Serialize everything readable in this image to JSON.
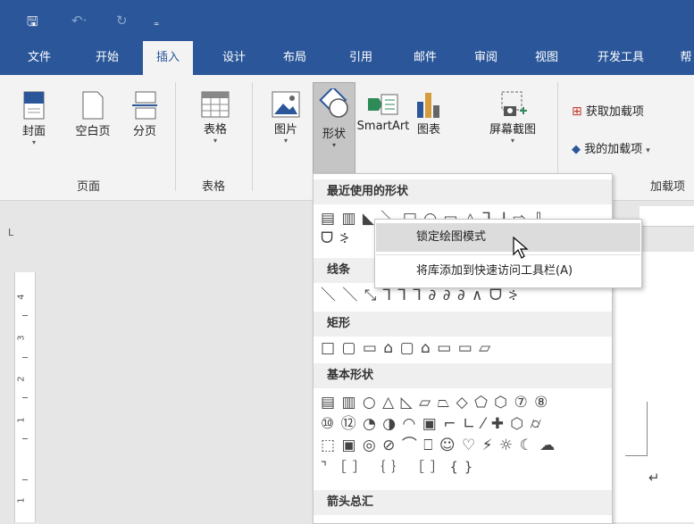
{
  "qat": {
    "save_icon": "save-icon",
    "undo_icon": "undo-icon",
    "redo_icon": "redo-icon",
    "customize_icon": "customize-qat-icon",
    "save": "🖫",
    "undo": "↶·",
    "redo": "↻",
    "customize": "₌"
  },
  "tabs": [
    {
      "label": "文件"
    },
    {
      "label": "开始"
    },
    {
      "label": "插入"
    },
    {
      "label": "设计"
    },
    {
      "label": "布局"
    },
    {
      "label": "引用"
    },
    {
      "label": "邮件"
    },
    {
      "label": "审阅"
    },
    {
      "label": "视图"
    },
    {
      "label": "开发工具"
    },
    {
      "label": "帮"
    }
  ],
  "ribbon": {
    "pages_group": {
      "label": "页面",
      "cover": "封面",
      "blank": "空白页",
      "break": "分页"
    },
    "tables_group": {
      "label": "表格",
      "table": "表格"
    },
    "illustrations": {
      "picture": "图片",
      "shapes": "形状",
      "smartart": "SmartArt",
      "chart": "图表",
      "screenshot": "屏幕截图"
    },
    "addins": {
      "label": "加载项",
      "get": "获取加载项",
      "my": "我的加载项"
    },
    "dropdown_arrow": "▾"
  },
  "gallery": {
    "recent": "最近使用的形状",
    "lines": "线条",
    "rect": "矩形",
    "basic": "基本形状",
    "arrows": "箭头总汇",
    "rows": {
      "recent1": "▤ ▥ ◣ ＼ □ ○ ▭ △ ⅂ ⅃ ⇨ ⇩",
      "recent2": "ᗜ ⸖",
      "lines1": "＼ ＼ ⤡ ⅂ ⅂ ⅂ ∂ ∂ ∂ ∧ ᗜ ⸖",
      "rect1": "□ ▢ ▭ ⌂ ▢ ⌂ ▭ ▭ ▱",
      "basic1": "▤ ▥ ○ △ ◺ ▱ ⏢ ◇ ⬠ ⬡ ⑦ ⑧",
      "basic2": "⑩ ⑫ ◔ ◑ ◠ ▣ ⌐ ∟ ⁄ ✚ ⬡ ⌭",
      "basic3": "⬚ ▣ ◎ ⊘ ⌒ ⎕ ☺ ♡ ⚡ ☼ ☾ ☁",
      "basic4": "⌝ ［ ］ ｛ ｝ ［  ］  {  }"
    }
  },
  "context_menu": {
    "lock": "锁定绘图模式",
    "add_qat": "将库添加到快速访问工具栏(A)"
  },
  "vruler": {
    "n4": "4",
    "n3": "3",
    "n2": "2",
    "n1": "1",
    "n0": "1"
  },
  "corner": "L",
  "return_mark": "↵"
}
